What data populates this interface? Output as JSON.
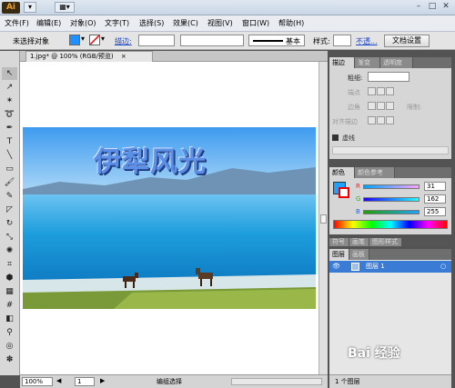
{
  "titlebar": {
    "app_logo": "Ai",
    "buttons": [
      "▾",
      "▦▾"
    ],
    "window_controls": [
      "–",
      "□",
      "✕"
    ]
  },
  "menu": [
    "文件(F)",
    "编辑(E)",
    "对象(O)",
    "文字(T)",
    "选择(S)",
    "效果(C)",
    "视图(V)",
    "窗口(W)",
    "帮助(H)"
  ],
  "controlbar": {
    "selection_status": "未选择对象",
    "stroke_label": "描边:",
    "stroke_weight": "基本",
    "style_label": "样式:",
    "opacity_link": "不透...",
    "doc_settings_button": "文档设置",
    "fill_color": "#1e90ff"
  },
  "doc": {
    "tab_title": "1.jpg* @ 100% (RGB/预览)",
    "tab_close": "×",
    "artwork_text": "伊犁风光"
  },
  "statusbar": {
    "zoom": "100%",
    "artboard": "1",
    "mode": "编组选择"
  },
  "stroke_panel": {
    "tabs": [
      "描边",
      "渐变",
      "透明度"
    ],
    "weight_label": "粗细:",
    "cap_label": "端点",
    "corner_label": "边角",
    "limit_label": "限制:",
    "align_label": "对齐描边",
    "dash_label": "虚线"
  },
  "color_panel": {
    "tabs": [
      "颜色",
      "颜色参考"
    ],
    "channels": [
      {
        "name": "R",
        "value": "31",
        "color": "#e03030"
      },
      {
        "name": "G",
        "value": "162",
        "color": "#30b030"
      },
      {
        "name": "B",
        "value": "255",
        "color": "#3060e0"
      }
    ],
    "fill_color": "#1fa2ff"
  },
  "layers_panel": {
    "top_tabs": [
      "符号",
      "画笔",
      "图形样式"
    ],
    "tabs": [
      "图层",
      "画板"
    ],
    "layer_name": "图层 1",
    "footer": "1 个图层"
  },
  "watermark": "Bai 经验"
}
